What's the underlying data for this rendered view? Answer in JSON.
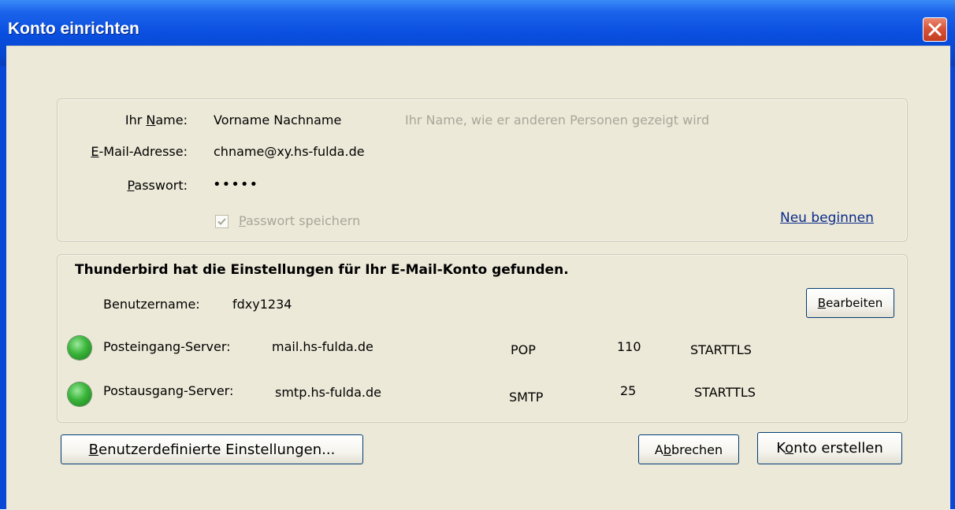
{
  "window": {
    "title": "Konto einrichten"
  },
  "form": {
    "name_label": "Ihr Name:",
    "name_value": "Vorname Nachname",
    "name_hint": "Ihr Name, wie er anderen Personen gezeigt wird",
    "email_label": "E-Mail-Adresse:",
    "email_value": "chname@xy.hs-fulda.de",
    "password_label": "Passwort:",
    "password_value": "•••••",
    "remember_label": "Passwort speichern",
    "remember_checked": true,
    "restart_link": "Neu beginnen"
  },
  "result": {
    "heading": "Thunderbird hat die Einstellungen für Ihr E-Mail-Konto gefunden.",
    "username_label": "Benutzername:",
    "username_value": "fdxy1234",
    "edit_button": "Bearbeiten",
    "incoming": {
      "label": "Posteingang-Server:",
      "host": "mail.hs-fulda.de",
      "protocol": "POP",
      "port": "110",
      "security": "STARTTLS",
      "status_color": "#2fa82f"
    },
    "outgoing": {
      "label": "Postausgang-Server:",
      "host": "smtp.hs-fulda.de",
      "protocol": "SMTP",
      "port": "25",
      "security": "STARTTLS",
      "status_color": "#2fa82f"
    }
  },
  "buttons": {
    "custom_settings": "Benutzerdefinierte Einstellungen...",
    "cancel": "Abbrechen",
    "create_account": "Konto erstellen"
  }
}
